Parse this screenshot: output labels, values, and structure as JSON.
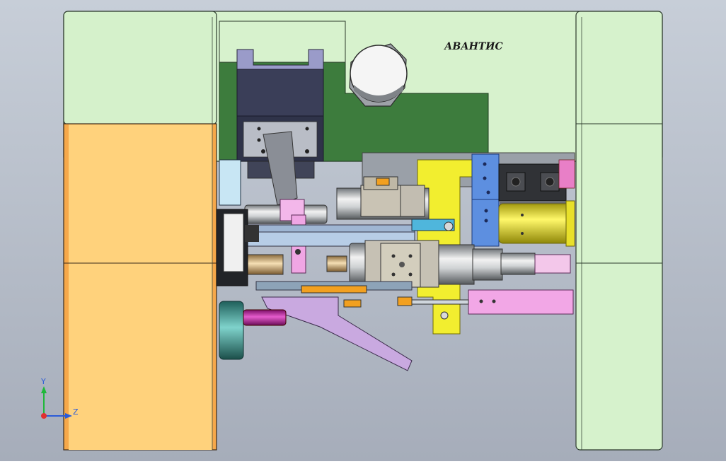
{
  "model": {
    "brand_label": "АВАНТИС"
  },
  "triad": {
    "y_label": "Y",
    "z_label": "Z",
    "colors": {
      "y": "#1fb83a",
      "z": "#2b5bd8",
      "origin": "#e03030"
    }
  },
  "colors": {
    "background_top": "#c5ccd6",
    "background_bottom": "#a7aebb",
    "frame_green": "#d6f0cc",
    "dark_green": "#3f7f3f",
    "orange_plate": "#f3a648",
    "cream_plate": "#ffd27a",
    "yellow_part": "#f2ee2f",
    "blue_block": "#5d8fe0",
    "pink_part": "#efa3e3",
    "magenta_part": "#c81aa7",
    "teal_part": "#4aa7a1",
    "navy_block": "#3a3e58"
  }
}
